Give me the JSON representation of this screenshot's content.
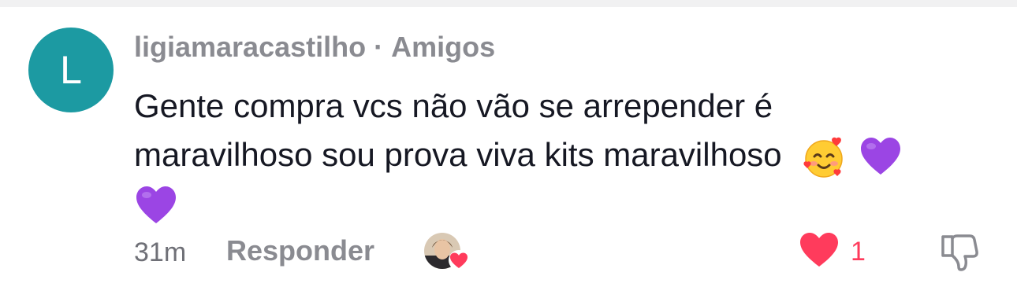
{
  "colors": {
    "avatar_bg": "#1c9aa2",
    "like_red": "#ff3b5c",
    "username_gray": "#8a8b91",
    "text_dark": "#161823"
  },
  "comment": {
    "avatar_initial": "L",
    "username": "ligiamaracastilho",
    "separator": "·",
    "relation": "Amigos",
    "text_line1": "Gente compra vcs não vão se arrepender é",
    "text_line2": "maravilhoso sou prova viva kits maravilhoso",
    "emojis": [
      "smiling-face-with-hearts",
      "purple-heart",
      "purple-heart"
    ],
    "time": "31m",
    "reply_label": "Responder",
    "like_count": "1",
    "icons": {
      "creator_like": "creator-avatar-with-heart-icon",
      "like": "heart-icon",
      "dislike": "thumbs-down-icon"
    }
  }
}
